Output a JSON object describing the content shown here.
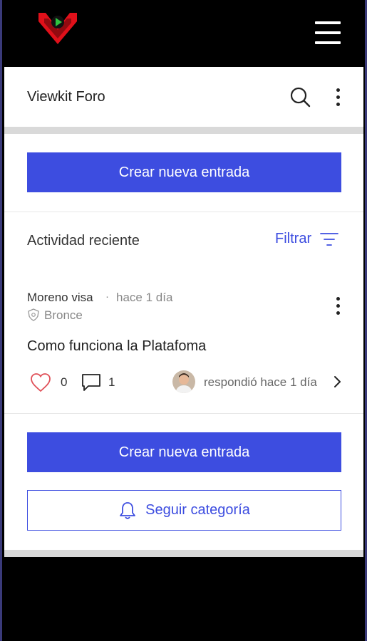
{
  "header": {
    "title": "Viewkit Foro"
  },
  "actions": {
    "create_entry_label": "Crear nueva entrada",
    "follow_category_label": "Seguir categoría"
  },
  "activity": {
    "title": "Actividad reciente",
    "filter_label": "Filtrar"
  },
  "post": {
    "author": "Moreno visa",
    "separator": "·",
    "time": "hace 1 día",
    "badge": "Bronce",
    "title": "Como funciona la Platafoma",
    "likes": "0",
    "comments": "1",
    "reply_text": "respondió hace 1 día"
  },
  "colors": {
    "accent": "#3d4de0",
    "logo_red": "#e0101a",
    "logo_play": "#2ec440"
  },
  "icons": [
    "logo",
    "menu-icon",
    "search-icon",
    "more-vertical-icon",
    "filter-icon",
    "shield-icon",
    "heart-icon",
    "comment-icon",
    "chevron-right-icon",
    "bell-icon"
  ]
}
